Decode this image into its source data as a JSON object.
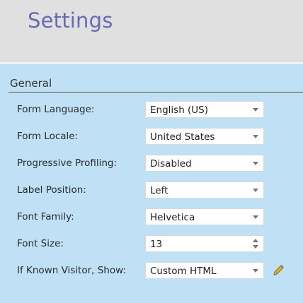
{
  "header": {
    "title": "Settings"
  },
  "section": {
    "title": "General"
  },
  "fields": [
    {
      "label": "Form Language:",
      "value": "English (US)",
      "control": "select",
      "icon": "chevron-down-icon"
    },
    {
      "label": "Form Locale:",
      "value": "United States",
      "control": "select",
      "icon": "chevron-down-icon"
    },
    {
      "label": "Progressive Profiling:",
      "value": "Disabled",
      "control": "select",
      "icon": "chevron-down-icon"
    },
    {
      "label": "Label Position:",
      "value": "Left",
      "control": "select",
      "icon": "chevron-down-icon"
    },
    {
      "label": "Font Family:",
      "value": "Helvetica",
      "control": "select",
      "icon": "chevron-down-icon"
    },
    {
      "label": "Font Size:",
      "value": "13",
      "control": "number",
      "icon": "spinner-arrows-icon"
    },
    {
      "label": "If Known Visitor, Show:",
      "value": "Custom HTML",
      "control": "select",
      "icon": "chevron-down-icon",
      "action_icon": "pencil-icon"
    }
  ],
  "colors": {
    "header_bg": "#e0e0e0",
    "title": "#6a6ab4",
    "panel_bg": "#bfe0f5",
    "pencil": "#d4a017"
  }
}
